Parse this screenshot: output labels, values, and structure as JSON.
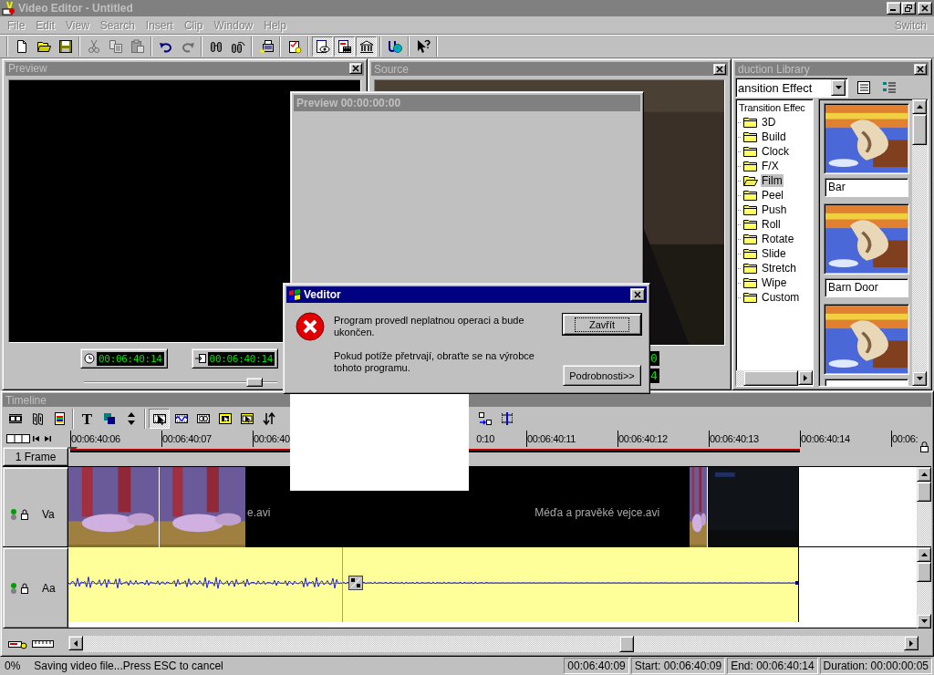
{
  "window": {
    "title": "Video Editor - Untitled"
  },
  "menu": {
    "items": [
      {
        "label": "File",
        "disabled": true
      },
      {
        "label": "Edit",
        "disabled": true
      },
      {
        "label": "View",
        "disabled": true
      },
      {
        "label": "Search",
        "disabled": true
      },
      {
        "label": "Insert",
        "disabled": true
      },
      {
        "label": "Clip",
        "disabled": true
      },
      {
        "label": "Window",
        "disabled": true
      },
      {
        "label": "Help",
        "disabled": true
      }
    ],
    "switch": {
      "label": "Switch",
      "disabled": true
    }
  },
  "toolbar": {
    "groups": [
      [
        {
          "kind": "new",
          "pressed": false,
          "disabled": false
        },
        {
          "kind": "open",
          "pressed": false,
          "disabled": false
        },
        {
          "kind": "save",
          "pressed": false,
          "disabled": false
        }
      ],
      [
        {
          "kind": "cut",
          "pressed": false,
          "disabled": true
        },
        {
          "kind": "copy",
          "pressed": false,
          "disabled": true
        },
        {
          "kind": "paste",
          "pressed": false,
          "disabled": true
        }
      ],
      [
        {
          "kind": "undo",
          "pressed": false,
          "disabled": false
        },
        {
          "kind": "redo",
          "pressed": false,
          "disabled": true
        }
      ],
      [
        {
          "kind": "find",
          "pressed": false,
          "disabled": false
        },
        {
          "kind": "findnext",
          "pressed": false,
          "disabled": false
        }
      ],
      [
        {
          "kind": "capture",
          "pressed": false,
          "disabled": false
        }
      ],
      [
        {
          "kind": "check",
          "pressed": false,
          "disabled": false
        }
      ],
      [
        {
          "kind": "preview",
          "pressed": true,
          "disabled": false
        },
        {
          "kind": "source",
          "pressed": true,
          "disabled": false
        },
        {
          "kind": "library",
          "pressed": true,
          "disabled": false
        }
      ],
      [
        {
          "kind": "web",
          "pressed": false,
          "disabled": false
        }
      ],
      [
        {
          "kind": "help",
          "pressed": false,
          "disabled": false
        }
      ]
    ]
  },
  "preview": {
    "title": "Preview",
    "position": "00:06:40:14",
    "end": "00:06:40:14",
    "slider": {
      "level": 0.92
    }
  },
  "source": {
    "title": "Source",
    "readouts": [
      "0",
      "4"
    ]
  },
  "library": {
    "title": "duction Library",
    "category": "ansition Effect",
    "tree": {
      "label": "Transition Effec",
      "children": [
        {
          "label": "3D",
          "selected": false
        },
        {
          "label": "Build",
          "selected": false
        },
        {
          "label": "Clock",
          "selected": false
        },
        {
          "label": "F/X",
          "selected": false
        },
        {
          "label": "Film",
          "selected": true
        },
        {
          "label": "Peel",
          "selected": false
        },
        {
          "label": "Push",
          "selected": false
        },
        {
          "label": "Roll",
          "selected": false
        },
        {
          "label": "Rotate",
          "selected": false
        },
        {
          "label": "Slide",
          "selected": false
        },
        {
          "label": "Stretch",
          "selected": false
        },
        {
          "label": "Wipe",
          "selected": false
        },
        {
          "label": "Custom",
          "selected": false
        }
      ]
    },
    "effects": [
      {
        "kind": "picture",
        "label": "Bar"
      },
      {
        "kind": "picture",
        "label": "Barn Door"
      },
      {
        "kind": "picture"
      }
    ]
  },
  "preview_window": {
    "title": "Preview 00:00:00:00"
  },
  "dialog": {
    "title": "Veditor",
    "message": "Program provedl neplatnou operaci a bude ukončen.",
    "hint": "Pokud potíže přetrvají, obraťte se na výrobce tohoto programu.",
    "buttons": [
      {
        "label": "Zavřít",
        "default": true
      },
      {
        "label": "Podrobnosti>>",
        "default": false
      }
    ]
  },
  "timeline": {
    "title": "Timeline",
    "tools": {
      "groups": [
        [
          {
            "kind": "film",
            "pressed": false
          },
          {
            "kind": "audio",
            "pressed": false
          },
          {
            "kind": "colorpage",
            "pressed": false
          }
        ],
        [
          {
            "kind": "text",
            "glyph": "T",
            "pressed": false
          },
          {
            "kind": "overlay",
            "pressed": false
          },
          {
            "kind": "updown",
            "pressed": false
          }
        ],
        [
          {
            "kind": "select",
            "pressed": true
          },
          {
            "kind": "wavecut",
            "pressed": false
          },
          {
            "kind": "loop",
            "pressed": false
          },
          {
            "kind": "arrowin",
            "pressed": false
          },
          {
            "kind": "arrowsel",
            "pressed": false
          },
          {
            "kind": "swap",
            "pressed": false
          }
        ],
        [
          {
            "kind": "split",
            "pressed": false
          },
          {
            "kind": "column",
            "pressed": false
          }
        ]
      ]
    },
    "ruler": [
      {
        "label": "00:06:40:06",
        "kind": "full"
      },
      {
        "label": "00:06:40:07",
        "kind": "full"
      },
      {
        "label": "00:06:40",
        "kind": "full"
      },
      {
        "label": "0:10",
        "kind": "tail"
      },
      {
        "label": "00:06:40:11",
        "kind": "full"
      },
      {
        "label": "00:06:40:12",
        "kind": "full"
      },
      {
        "label": "00:06:40:13",
        "kind": "full"
      },
      {
        "label": "00:06:40:14",
        "kind": "full"
      },
      {
        "label": "00:06:",
        "kind": "full"
      }
    ],
    "zoom": "1 Frame",
    "tracks": [
      {
        "kind": "video",
        "name": "Va",
        "clips": [
          "e.avi",
          "Méďa a pravěké vejce.avi"
        ]
      },
      {
        "kind": "audio",
        "name": "Aa"
      }
    ]
  },
  "status_bar": {
    "progress": "0%",
    "message": "Saving video file...Press ESC to cancel",
    "position": "00:06:40:09",
    "start": "Start: 00:06:40:09",
    "end": "End: 00:06:40:14",
    "duration": "Duration: 00:00:00:05"
  }
}
